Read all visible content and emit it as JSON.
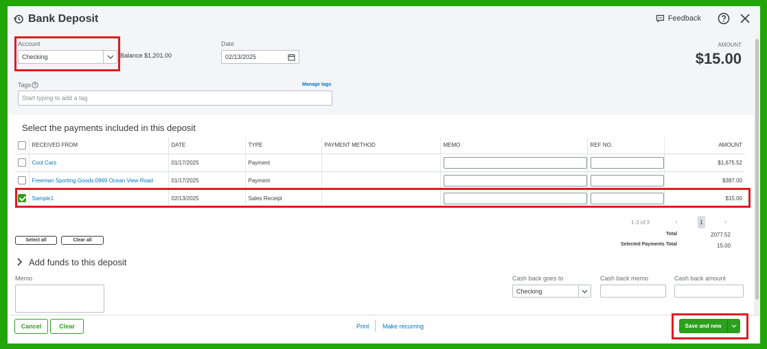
{
  "window": {
    "title": "Bank Deposit",
    "feedback_label": "Feedback"
  },
  "account": {
    "label": "Account",
    "value": "Checking",
    "balance": "Balance $1,201.00"
  },
  "date": {
    "label": "Date",
    "value": "02/13/2025"
  },
  "amount": {
    "label": "AMOUNT",
    "value": "$15.00"
  },
  "tags": {
    "label": "Tags",
    "manage_label": "Manage tags",
    "placeholder": "Start typing to add a tag"
  },
  "payments": {
    "section_title": "Select the payments included in this deposit",
    "columns": [
      "RECEIVED FROM",
      "DATE",
      "TYPE",
      "PAYMENT METHOD",
      "MEMO",
      "REF NO.",
      "AMOUNT"
    ],
    "rows": [
      {
        "received_from": "Cool Cars",
        "date": "01/17/2025",
        "type": "Payment",
        "method": "",
        "amount": "$1,675.52",
        "checked": false
      },
      {
        "received_from": "Freeman Sporting Goods:0969 Ocean View Road",
        "date": "01/17/2025",
        "type": "Payment",
        "method": "",
        "amount": "$387.00",
        "checked": false
      },
      {
        "received_from": "Sample1",
        "date": "02/13/2025",
        "type": "Sales Receipt",
        "method": "",
        "amount": "$15.00",
        "checked": true
      }
    ],
    "pagination": "1-3 of 3",
    "current_page": "1",
    "select_all_label": "Select all",
    "clear_all_label": "Clear all",
    "total_label": "Total",
    "total_value": "2077.52",
    "selected_total_label": "Selected Payments Total",
    "selected_total_value": "15.00"
  },
  "add_funds": {
    "title": "Add funds to this deposit",
    "memo_label": "Memo",
    "cash_back_goes_to_label": "Cash back goes to",
    "cash_back_goes_to_value": "Checking",
    "cash_back_memo_label": "Cash back memo",
    "cash_back_amount_label": "Cash back amount"
  },
  "footer": {
    "cancel_label": "Cancel",
    "clear_label": "Clear",
    "print_label": "Print",
    "make_recurring_label": "Make recurring",
    "save_new_label": "Save and new"
  },
  "colors": {
    "frame_green": "#22a50a",
    "accent_green": "#2ca01c",
    "link_blue": "#0077c5",
    "highlight_red": "#e0191f"
  }
}
